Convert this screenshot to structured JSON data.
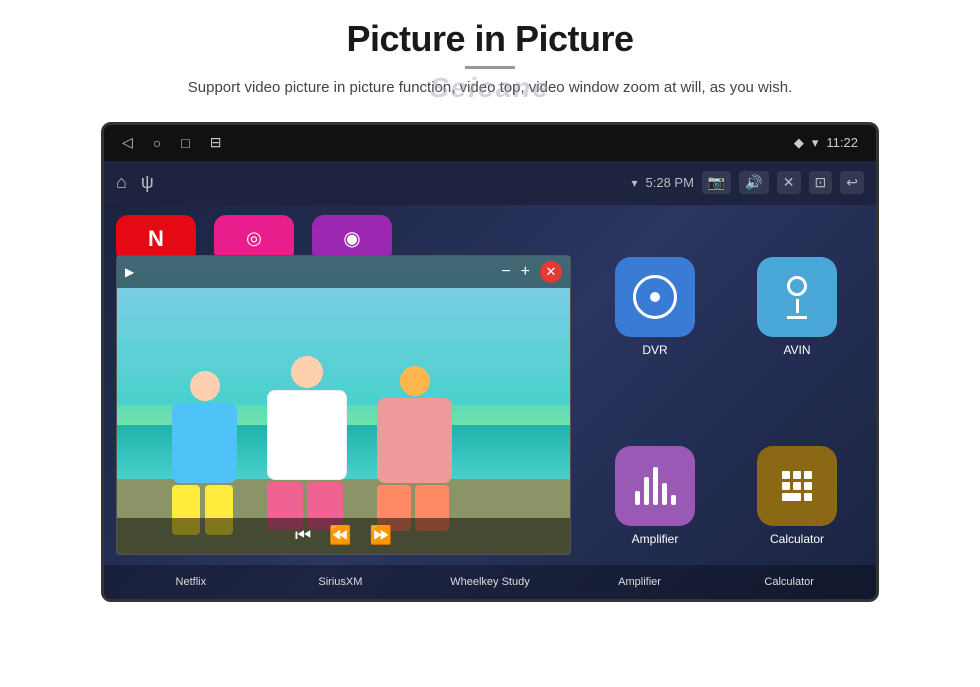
{
  "page": {
    "title": "Picture in Picture",
    "divider": true,
    "watermark": "Seicane",
    "subtitle": "Support video picture in picture function, video top, video window zoom at will, as you wish."
  },
  "device": {
    "status_bar": {
      "nav_icons": [
        "◁",
        "○",
        "□",
        "⊟"
      ],
      "wifi_icon": "▾",
      "battery_icon": "▾",
      "time": "11:22"
    },
    "top_bar": {
      "home_icon": "⌂",
      "usb_icon": "⚡",
      "wifi": "▾",
      "clock": "5:28 PM",
      "icons_right": [
        "📷",
        "🔊",
        "✕",
        "⊡",
        "↩"
      ]
    }
  },
  "pip": {
    "control_minus": "−",
    "control_plus": "+",
    "control_close": "✕",
    "media_prev": "⏮",
    "media_play": "⏪",
    "media_next": "⏩"
  },
  "apps": {
    "top_row": [
      {
        "id": "dvr",
        "label": "DVR",
        "color": "#3a7bd5"
      },
      {
        "id": "avin",
        "label": "AVIN",
        "color": "#4aa8d8"
      }
    ],
    "bottom_row": [
      {
        "id": "amplifier",
        "label": "Amplifier",
        "color": "#9b59b6"
      },
      {
        "id": "calculator",
        "label": "Calculator",
        "color": "#8B6914"
      }
    ],
    "left_row": [
      {
        "id": "netflix",
        "label": "Netflix",
        "color": "#e50914"
      },
      {
        "id": "sirius",
        "label": "SiriusXM",
        "color": "#e91e8c"
      },
      {
        "id": "wheelkey",
        "label": "Wheelkey Study",
        "color": "#9c27b0"
      }
    ]
  },
  "bottom_labels": [
    "Netflix",
    "SiriusXM",
    "Wheelkey Study",
    "Amplifier",
    "Calculator"
  ]
}
